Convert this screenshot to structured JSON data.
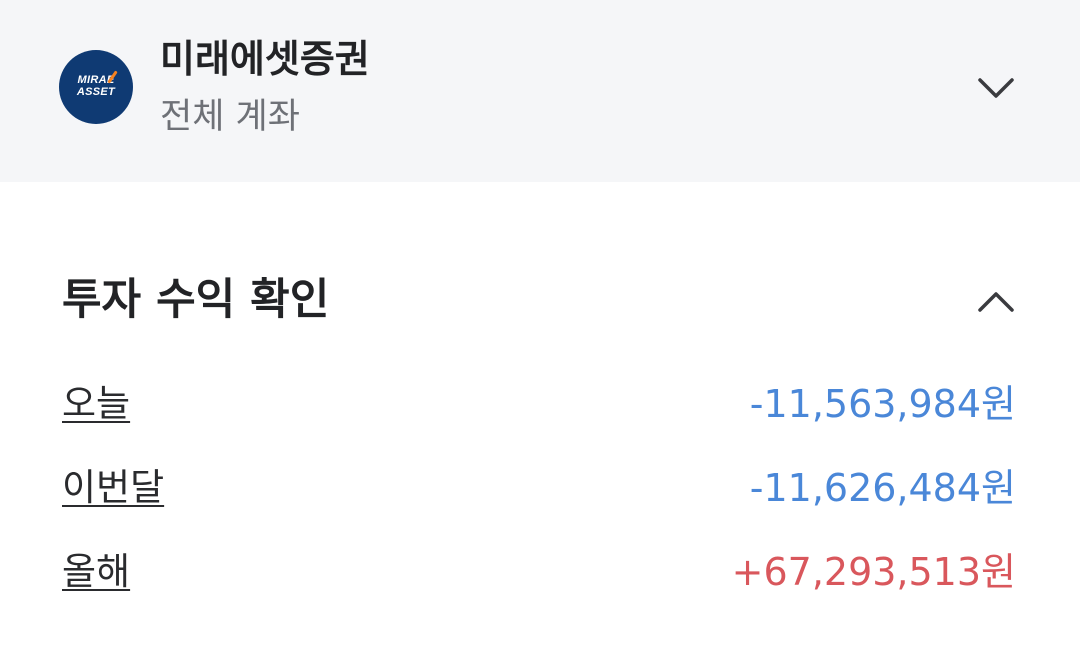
{
  "account_header": {
    "logo_text_line1": "MIRAE",
    "logo_text_line2": "ASSET",
    "broker_name": "미래에셋증권",
    "account_scope": "전체 계좌",
    "toggle_icon": "chevron-down-icon"
  },
  "returns_section": {
    "title": "투자 수익 확인",
    "toggle_icon": "chevron-up-icon",
    "rows": [
      {
        "label": "오늘",
        "value": "-11,563,984원",
        "trend": "loss"
      },
      {
        "label": "이번달",
        "value": "-11,626,484원",
        "trend": "loss"
      },
      {
        "label": "올해",
        "value": "+67,293,513원",
        "trend": "gain"
      }
    ]
  },
  "colors": {
    "loss": "#4a87d8",
    "gain": "#d9575c",
    "header_bg": "#f5f6f8",
    "logo_bg": "#0f3a73"
  }
}
